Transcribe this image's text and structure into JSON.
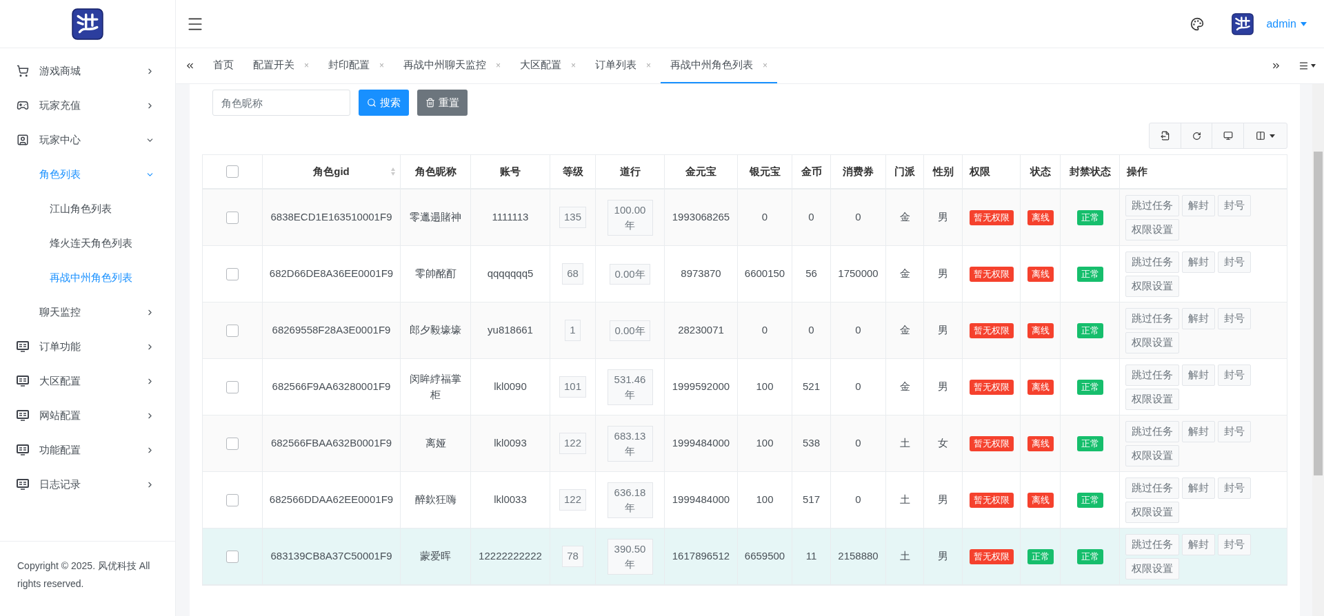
{
  "header": {
    "user": "admin"
  },
  "sidebar": {
    "items": [
      {
        "label": "游戏商城",
        "expanded": false,
        "selected": false
      },
      {
        "label": "玩家充值",
        "expanded": false,
        "selected": false
      },
      {
        "label": "玩家中心",
        "expanded": true,
        "selected": false,
        "children": [
          {
            "label": "角色列表",
            "expanded": true,
            "selected": true,
            "children": [
              {
                "label": "江山角色列表",
                "selected": false
              },
              {
                "label": "烽火连天角色列表",
                "selected": false
              },
              {
                "label": "再战中州角色列表",
                "selected": true
              }
            ]
          },
          {
            "label": "聊天监控",
            "expanded": false,
            "selected": false
          }
        ]
      },
      {
        "label": "订单功能",
        "expanded": false,
        "selected": false
      },
      {
        "label": "大区配置",
        "expanded": false,
        "selected": false
      },
      {
        "label": "网站配置",
        "expanded": false,
        "selected": false
      },
      {
        "label": "功能配置",
        "expanded": false,
        "selected": false
      },
      {
        "label": "日志记录",
        "expanded": false,
        "selected": false
      }
    ],
    "footer": "Copyright © 2025. 风优科技 All rights reserved."
  },
  "tabs": [
    {
      "label": "首页",
      "selected": false
    },
    {
      "label": "配置开关",
      "close": "×",
      "selected": false
    },
    {
      "label": "封印配置",
      "close": "×",
      "selected": false
    },
    {
      "label": "再战中州聊天监控",
      "close": "×",
      "selected": false
    },
    {
      "label": "大区配置",
      "close": "×",
      "selected": false
    },
    {
      "label": "订单列表",
      "close": "×",
      "selected": false
    },
    {
      "label": "再战中州角色列表",
      "close": "×",
      "selected": true
    }
  ],
  "search": {
    "placeholder": "角色昵称",
    "buttons": [
      "搜索",
      "重置"
    ]
  },
  "table": {
    "select_all": {
      "checked": false
    },
    "columns": [
      {
        "label": "角色gid",
        "sortable": true
      },
      {
        "label": "角色昵称",
        "sortable": false
      },
      {
        "label": "账号",
        "sortable": false
      },
      {
        "label": "等级",
        "sortable": false
      },
      {
        "label": "道行",
        "sortable": false
      },
      {
        "label": "金元宝",
        "sortable": false
      },
      {
        "label": "银元宝",
        "sortable": false
      },
      {
        "label": "金币",
        "sortable": false
      },
      {
        "label": "消费券",
        "sortable": false
      },
      {
        "label": "门派",
        "sortable": false
      },
      {
        "label": "性别",
        "sortable": false
      },
      {
        "label": "权限",
        "sortable": false
      },
      {
        "label": "状态",
        "sortable": false
      },
      {
        "label": "封禁状态",
        "sortable": false
      },
      {
        "label": "操作",
        "sortable": false
      }
    ],
    "rows": [
      {
        "checked": false,
        "selected": false,
        "gid": "6838ECD1E163510001F9",
        "name": "零邋遢賭神",
        "account": "1111113",
        "level": "135",
        "daoxing": "100.00年",
        "gold": "1993068265",
        "silver": "0",
        "coins": "0",
        "vouchers": "0",
        "sect": "金",
        "gender": "男",
        "permission": {
          "text": "暂无权限",
          "color": "#f5412d"
        },
        "status": {
          "text": "离线",
          "color": "#f5412d"
        },
        "ban": {
          "text": "正常",
          "color": "#16be6c"
        },
        "actions": [
          "跳过任务",
          "解封",
          "封号",
          "权限设置"
        ]
      },
      {
        "checked": false,
        "selected": false,
        "gid": "682D66DE8A36EE0001F9",
        "name": "零帥酩酊",
        "account": "qqqqqqq5",
        "level": "68",
        "daoxing": "0.00年",
        "gold": "8973870",
        "silver": "6600150",
        "coins": "56",
        "vouchers": "1750000",
        "sect": "金",
        "gender": "男",
        "permission": {
          "text": "暂无权限",
          "color": "#f5412d"
        },
        "status": {
          "text": "离线",
          "color": "#f5412d"
        },
        "ban": {
          "text": "正常",
          "color": "#16be6c"
        },
        "actions": [
          "跳过任务",
          "解封",
          "封号",
          "权限设置"
        ]
      },
      {
        "checked": false,
        "selected": false,
        "gid": "68269558F28A3E0001F9",
        "name": "郎夕毅壕壕",
        "account": "yu818661",
        "level": "1",
        "daoxing": "0.00年",
        "gold": "28230071",
        "silver": "0",
        "coins": "0",
        "vouchers": "0",
        "sect": "金",
        "gender": "男",
        "permission": {
          "text": "暂无权限",
          "color": "#f5412d"
        },
        "status": {
          "text": "离线",
          "color": "#f5412d"
        },
        "ban": {
          "text": "正常",
          "color": "#16be6c"
        },
        "actions": [
          "跳过任务",
          "解封",
          "封号",
          "权限设置"
        ]
      },
      {
        "checked": false,
        "selected": false,
        "gid": "682566F9AA63280001F9",
        "name": "闵眸綍福掌柜",
        "account": "lkl0090",
        "level": "101",
        "daoxing": "531.46年",
        "gold": "1999592000",
        "silver": "100",
        "coins": "521",
        "vouchers": "0",
        "sect": "金",
        "gender": "男",
        "permission": {
          "text": "暂无权限",
          "color": "#f5412d"
        },
        "status": {
          "text": "离线",
          "color": "#f5412d"
        },
        "ban": {
          "text": "正常",
          "color": "#16be6c"
        },
        "actions": [
          "跳过任务",
          "解封",
          "封号",
          "权限设置"
        ]
      },
      {
        "checked": false,
        "selected": false,
        "gid": "682566FBAA632B0001F9",
        "name": "离娅",
        "account": "lkl0093",
        "level": "122",
        "daoxing": "683.13年",
        "gold": "1999484000",
        "silver": "100",
        "coins": "538",
        "vouchers": "0",
        "sect": "土",
        "gender": "女",
        "permission": {
          "text": "暂无权限",
          "color": "#f5412d"
        },
        "status": {
          "text": "离线",
          "color": "#f5412d"
        },
        "ban": {
          "text": "正常",
          "color": "#16be6c"
        },
        "actions": [
          "跳过任务",
          "解封",
          "封号",
          "权限设置"
        ]
      },
      {
        "checked": false,
        "selected": false,
        "gid": "682566DDAA62EE0001F9",
        "name": "醉欽狂嗨",
        "account": "lkl0033",
        "level": "122",
        "daoxing": "636.18年",
        "gold": "1999484000",
        "silver": "100",
        "coins": "517",
        "vouchers": "0",
        "sect": "土",
        "gender": "男",
        "permission": {
          "text": "暂无权限",
          "color": "#f5412d"
        },
        "status": {
          "text": "离线",
          "color": "#f5412d"
        },
        "ban": {
          "text": "正常",
          "color": "#16be6c"
        },
        "actions": [
          "跳过任务",
          "解封",
          "封号",
          "权限设置"
        ]
      },
      {
        "checked": false,
        "selected": true,
        "gid": "683139CB8A37C50001F9",
        "name": "蒙爱晖",
        "account": "12222222222",
        "level": "78",
        "daoxing": "390.50年",
        "gold": "1617896512",
        "silver": "6659500",
        "coins": "11",
        "vouchers": "2158880",
        "sect": "土",
        "gender": "男",
        "permission": {
          "text": "暂无权限",
          "color": "#f5412d"
        },
        "status": {
          "text": "正常",
          "color": "#16be6c"
        },
        "ban": {
          "text": "正常",
          "color": "#16be6c"
        },
        "actions": [
          "跳过任务",
          "解封",
          "封号",
          "权限设置"
        ]
      }
    ]
  }
}
